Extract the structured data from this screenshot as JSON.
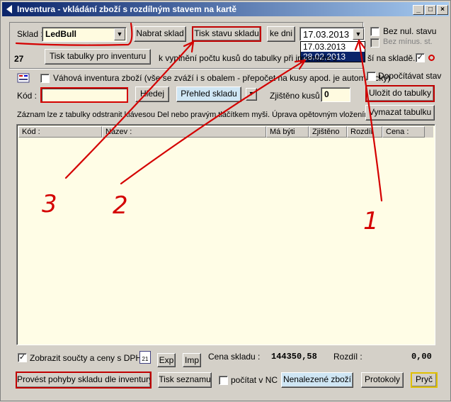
{
  "window": {
    "title": "Inventura - vkládání zboží s rozdílným stavem na kartě",
    "minimize": "_",
    "maximize": "□",
    "close": "×"
  },
  "row1": {
    "sklad_label": "Sklad :",
    "sklad_value": "LedBull",
    "nabrat_sklad": "Nabrat sklad",
    "tisk_stavu": "Tisk stavu skladu",
    "ke_dni": "ke dni",
    "date_value": "17.03.2013",
    "date_options": [
      "17.03.2013",
      "28.02.2013"
    ],
    "bez_nul_stavu": "Bez nul. stavu",
    "bez_minus": "Bez mínus. st."
  },
  "row2": {
    "count": "27",
    "tisk_tabulky": "Tisk tabulky pro inventuru",
    "info_text": "k vyplnění počtu kusů do tabulky při inventuře s",
    "info_tail": "ší na skladě."
  },
  "row3": {
    "vahova_label": "Váhová inventura zboží (vše se zváží i s obalem - přepočet na kusy apod. je automatický)",
    "dopocitavat": "Dopočítávat stav"
  },
  "row4": {
    "kod_label": "Kód :",
    "kod_value": "",
    "hledej": "Hledej",
    "prehled": "Přehled skladu",
    "prehled_dd": "▾",
    "zjisteno_label": "Zjištěno kusů :",
    "zjisteno_value": "0",
    "ulozit": "Uložit do tabulky"
  },
  "row5": {
    "hint": "Záznam lze z tabulky odstranit klávesou Del nebo pravým tlačítkem myši. Úprava opětovným vložením.",
    "vymazat": "Vymazat tabulku"
  },
  "table": {
    "columns": [
      "Kód :",
      "Název :",
      "Má býti",
      "Zjištěno",
      "Rozdíl",
      "Cena :"
    ],
    "rows": []
  },
  "bottom": {
    "zobrazit": "Zobrazit součty a ceny s DPH",
    "calendar_day": "21",
    "exp": "Exp",
    "imp": "Imp",
    "cena_label": "Cena skladu :",
    "cena_value": "144350,58",
    "rozdil_label": "Rozdíl :",
    "rozdil_value": "0,00"
  },
  "footer": {
    "provest": "Provést pohyby skladu dle inventury",
    "tisk_seznamu": "Tisk seznamu",
    "pocitat_nc": "počítat v NC",
    "nenalezene": "Nenalezené zboží",
    "protokoly": "Protokoly",
    "pryc": "Pryč"
  },
  "annotations": {
    "n1": "1",
    "n2": "2",
    "n3": "3"
  },
  "colors": {
    "titlebar": "#0a246a",
    "annotation": "#d40000",
    "grid_bg": "#fffde6",
    "highlight": "#0a246a"
  }
}
